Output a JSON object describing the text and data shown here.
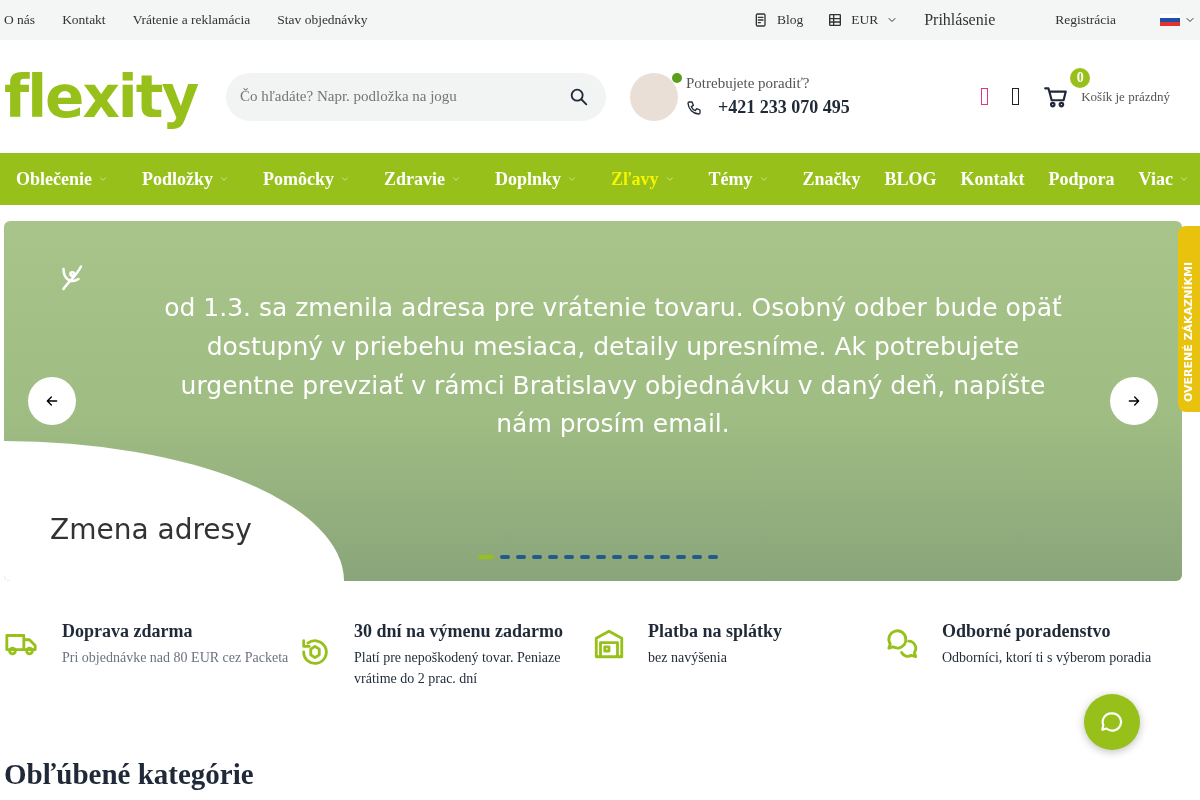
{
  "top_bar": {
    "links": [
      "O nás",
      "Kontakt",
      "Vrátenie a reklamácia",
      "Stav objednávky"
    ],
    "blog": "Blog",
    "currency": "EUR",
    "login": "Prihlásenie",
    "register": "Registrácia"
  },
  "header": {
    "logo": "flexity",
    "search": {
      "placeholder": "Čo hľadáte? Napr. podložka na jogu"
    },
    "advisor": {
      "online": true,
      "question": "Potrebujete poradiť?",
      "phone": "+421 233 070 495"
    },
    "cart": {
      "count": "0",
      "label": "Košík je prázdný"
    }
  },
  "menu": [
    {
      "label": "Oblečenie",
      "dropdown": true,
      "highlighted": false
    },
    {
      "label": "Podložky",
      "dropdown": true,
      "highlighted": false
    },
    {
      "label": "Pomôcky",
      "dropdown": true,
      "highlighted": false
    },
    {
      "label": "Zdravie",
      "dropdown": true,
      "highlighted": false
    },
    {
      "label": "Doplnky",
      "dropdown": true,
      "highlighted": false
    },
    {
      "label": "Zľavy",
      "dropdown": true,
      "highlighted": true
    },
    {
      "label": "Témy",
      "dropdown": true,
      "highlighted": false
    },
    {
      "label": "Značky",
      "dropdown": false,
      "highlighted": false
    },
    {
      "label": "BLOG",
      "dropdown": false,
      "highlighted": false
    },
    {
      "label": "Kontakt",
      "dropdown": false,
      "highlighted": false
    },
    {
      "label": "Podpora",
      "dropdown": false,
      "highlighted": false
    },
    {
      "label": "Viac",
      "dropdown": true,
      "highlighted": false
    }
  ],
  "banner": {
    "text": "od 1.3. sa zmenila adresa pre vrátenie tovaru. Osobný odber bude opäť dostupný v priebehu mesiaca, detaily upresníme. Ak potrebujete urgentne prevziať v rámci Bratislavy objednávku v daný deň, napíšte nám prosím email.",
    "caption": "Zmena adresy",
    "dots": [
      {
        "selected": true
      },
      {
        "selected": false
      },
      {
        "selected": false
      },
      {
        "selected": false
      },
      {
        "selected": false
      },
      {
        "selected": false
      },
      {
        "selected": false
      },
      {
        "selected": false
      },
      {
        "selected": false
      },
      {
        "selected": false
      },
      {
        "selected": false
      },
      {
        "selected": false
      },
      {
        "selected": false
      },
      {
        "selected": false
      },
      {
        "selected": false
      }
    ]
  },
  "side_badge": "OVERENÉ ZÁKAZNÍKMI",
  "benefits": [
    {
      "kind": "truck",
      "title": "Doprava zdarma",
      "text": "Pri objednávke nad 80 EUR cez Packeta",
      "muted": true
    },
    {
      "kind": "return",
      "title": "30 dní na výmenu zadarmo",
      "text": "Platí pre nepoškodený tovar. Peniaze vrátime do 2 prac. dní",
      "muted": false
    },
    {
      "kind": "warehouse",
      "title": "Platba na splátky",
      "text": "bez navýšenia",
      "muted": false
    },
    {
      "kind": "chat",
      "title": "Odborné poradenstvo",
      "text": "Odborníci, ktorí ti s výberom poradia",
      "muted": false
    }
  ],
  "section_title": "Obľúbené kategórie"
}
